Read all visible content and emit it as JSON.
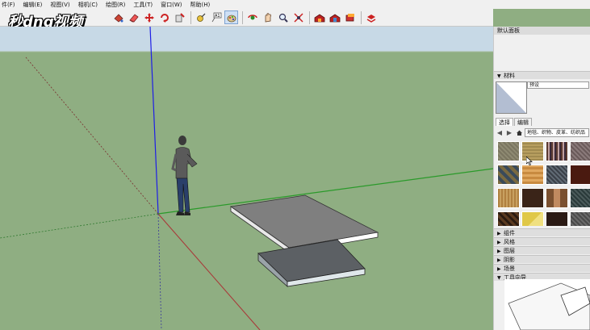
{
  "menu": [
    "件(F)",
    "编辑(E)",
    "视图(V)",
    "相机(C)",
    "绘图(R)",
    "工具(T)",
    "窗口(W)",
    "帮助(H)"
  ],
  "logo_text": "秒dng视频",
  "toolbar": {
    "icons": [
      "select-icon",
      "eraser-icon",
      "paint-bucket-icon",
      "separator",
      "move-icon",
      "rotate-icon",
      "push-pull-icon",
      "offset-icon",
      "separator",
      "tape-measure-icon",
      "text-tool-icon",
      "paint-tool-icon",
      "separator",
      "orbit-icon",
      "pan-icon",
      "zoom-icon",
      "zoom-extents-icon",
      "separator",
      "warehouse-icon",
      "extension-warehouse-icon",
      "separator",
      "layers-icon"
    ]
  },
  "colors": {
    "sky": "#c7d9e6",
    "ground": "#8fae82",
    "blue_axis": "#1e1ee6",
    "green_axis": "#2a9a2a",
    "red_axis": "#a83a3a",
    "accent": "#7ea3d1"
  },
  "tray": {
    "title": "默认面板",
    "materials": {
      "header": "材料",
      "preset_name": "预设",
      "tabs": [
        "选择",
        "编辑"
      ],
      "library": "地毯、织物、皮革、纺织品"
    },
    "sections": [
      "组件",
      "风格",
      "图层",
      "阴影",
      "场景",
      "工具向导"
    ]
  }
}
